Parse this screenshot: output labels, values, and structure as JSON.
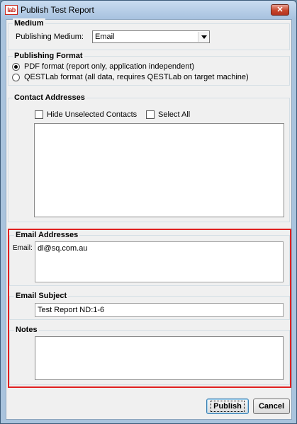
{
  "window": {
    "title": "Publish Test Report",
    "app_icon_text": "lab",
    "close_icon": "close-x-icon",
    "close_glyph": "✕"
  },
  "medium": {
    "legend": "Medium",
    "label": "Publishing Medium:",
    "selected": "Email"
  },
  "format": {
    "legend": "Publishing Format",
    "options": [
      {
        "label": "PDF format (report only, application independent)",
        "selected": true
      },
      {
        "label": "QESTLab format (all data, requires QESTLab on target machine)",
        "selected": false
      }
    ]
  },
  "contacts": {
    "legend": "Contact Addresses",
    "hide_unselected_label": "Hide Unselected Contacts",
    "select_all_label": "Select All",
    "hide_unselected_checked": false,
    "select_all_checked": false
  },
  "email_addresses": {
    "legend": "Email Addresses",
    "label": "Email:",
    "value": "dl@sq.com.au"
  },
  "email_subject": {
    "legend": "Email Subject",
    "value": "Test Report ND:1-6"
  },
  "notes": {
    "legend": "Notes",
    "value": ""
  },
  "buttons": {
    "publish": "Publish",
    "cancel": "Cancel"
  },
  "colors": {
    "highlight": "#e02020",
    "title_bar": "#a7c2df",
    "close_button": "#c8462c"
  }
}
